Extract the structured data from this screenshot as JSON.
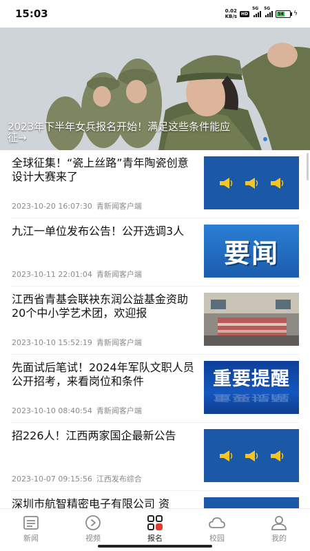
{
  "status_bar": {
    "time": "15:03",
    "net_speed_value": "0.02",
    "net_speed_unit": "KB/s",
    "hd_badge": "HD",
    "sim1_label": "5G",
    "sim2_label": "5G",
    "battery_level": "54"
  },
  "banner": {
    "caption": "2023年下半年女兵报名开始！满足这些条件能应征→"
  },
  "news": [
    {
      "title": "全球征集！“瓷上丝路”青年陶瓷创意设计大赛来了",
      "time": "2023-10-20 16:07:30",
      "source": "青新闻客户端",
      "thumb": "horn-speakers"
    },
    {
      "title": "九江一单位发布公告！公开选调3人",
      "time": "2023-10-11 22:01:04",
      "source": "青新闻客户端",
      "thumb": "yaowen",
      "thumb_text": "要闻"
    },
    {
      "title": "江西省青基会联袂东润公益基金资助20个中小学艺术团，欢迎报",
      "time": "2023-10-10 15:52:19",
      "source": "青新闻客户端",
      "thumb": "event-photo"
    },
    {
      "title": "先面试后笔试！2024年军队文职人员公开招考，来看岗位和条件",
      "time": "2023-10-10 08:40:54",
      "source": "青新闻客户端",
      "thumb": "reminder",
      "thumb_text": "重要提醒"
    },
    {
      "title": "招226人！江西两家国企最新公告",
      "time": "2023-10-07 09:15:56",
      "source": "江西发布综合",
      "thumb": "horn-speakers"
    },
    {
      "title": "深圳市航智精密电子有限公司 资",
      "thumb": "partial"
    }
  ],
  "bottom_nav": [
    {
      "label": "新闻",
      "icon": "news-icon"
    },
    {
      "label": "视频",
      "icon": "video-play-icon"
    },
    {
      "label": "报名",
      "icon": "grid-icon"
    },
    {
      "label": "校园",
      "icon": "cloud-icon"
    },
    {
      "label": "我的",
      "icon": "person-icon"
    }
  ],
  "colors": {
    "thumb_blue": "#1b59a8",
    "horn_yellow": "#f5c623",
    "meta_gray": "#8a8a8a",
    "banner_dot": "#2e7dd6"
  }
}
